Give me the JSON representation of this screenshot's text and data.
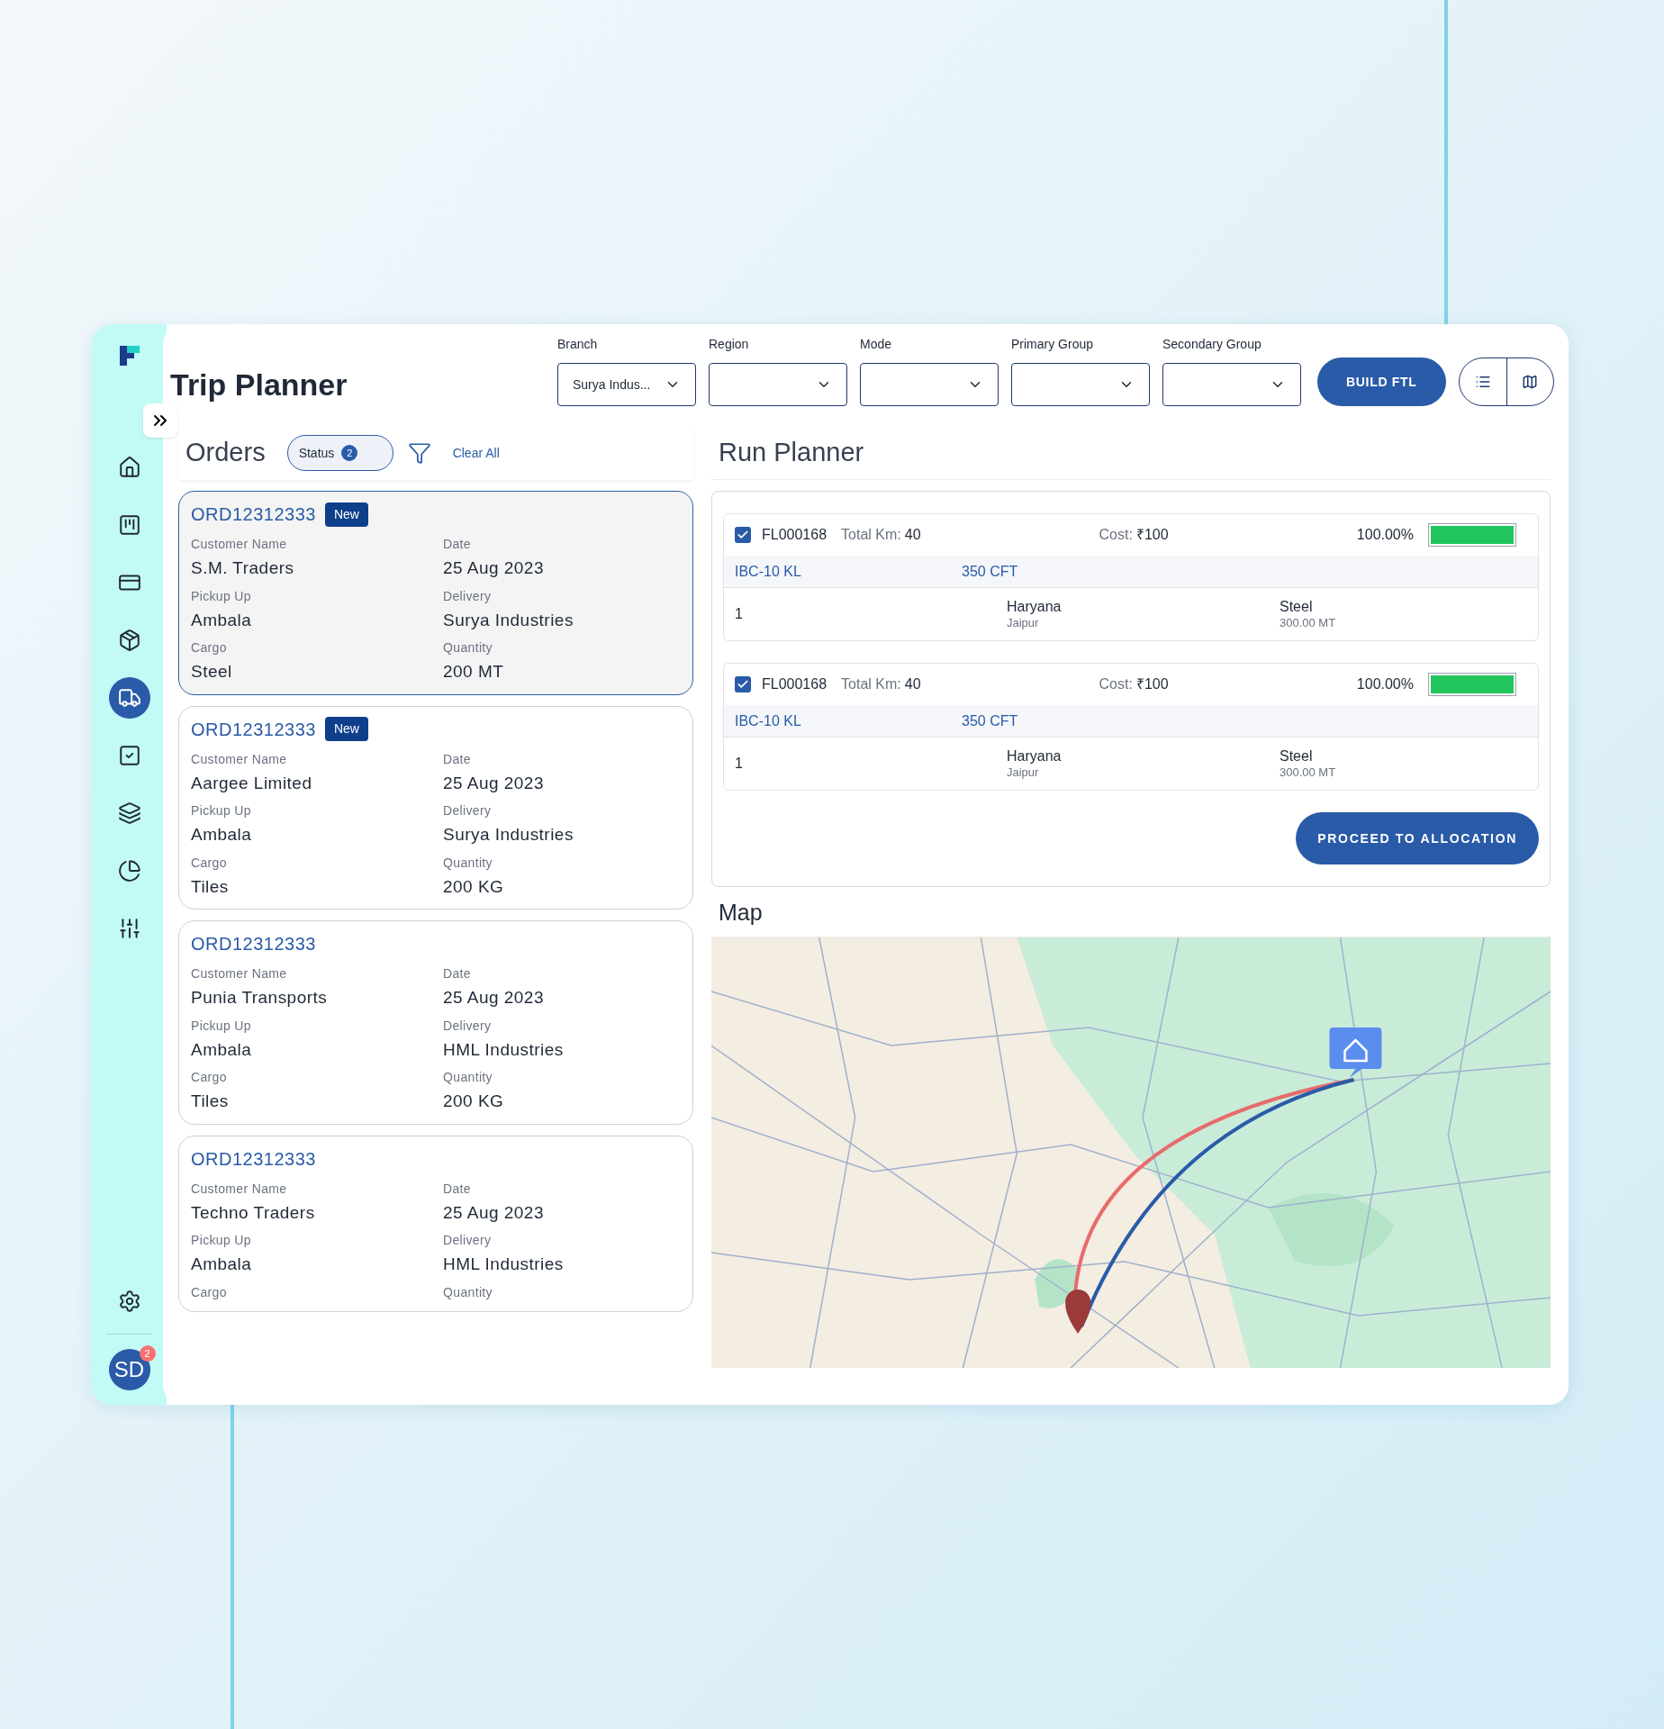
{
  "page": {
    "title": "Trip Planner"
  },
  "sidebar": {
    "items": [
      {
        "selected": false
      },
      {
        "selected": false
      },
      {
        "selected": false
      },
      {
        "selected": false
      },
      {
        "selected": true
      },
      {
        "selected": false
      },
      {
        "selected": false
      },
      {
        "selected": false
      },
      {
        "selected": false
      }
    ],
    "user": {
      "initials": "SD",
      "badge": "2"
    }
  },
  "filters": [
    {
      "label": "Branch",
      "value": "Surya Indus..."
    },
    {
      "label": "Region"
    },
    {
      "label": "Mode"
    },
    {
      "label": "Primary Group"
    },
    {
      "label": "Secondary Group"
    }
  ],
  "build_button": "BUILD FTL",
  "view_toggle": [
    {
      "kind": "list",
      "selected": false
    },
    {
      "kind": "map",
      "selected": false
    }
  ],
  "orders": {
    "title": "Orders",
    "status_chip": {
      "label": "Status",
      "count": "2"
    },
    "clear_all": "Clear All",
    "items": [
      {
        "id": "ORD12312333",
        "badge": "New",
        "selected": true,
        "fields": [
          {
            "label": "Customer Name",
            "value": "S.M. Traders"
          },
          {
            "label": "Date",
            "value": "25 Aug 2023"
          },
          {
            "label": "Pickup Up",
            "value": "Ambala"
          },
          {
            "label": "Delivery",
            "value": "Surya Industries"
          },
          {
            "label": "Cargo",
            "value": "Steel"
          },
          {
            "label": "Quantity",
            "value": "200 MT"
          }
        ]
      },
      {
        "id": "ORD12312333",
        "badge": "New",
        "selected": false,
        "fields": [
          {
            "label": "Customer Name",
            "value": "Aargee Limited"
          },
          {
            "label": "Date",
            "value": "25 Aug 2023"
          },
          {
            "label": "Pickup Up",
            "value": "Ambala"
          },
          {
            "label": "Delivery",
            "value": "Surya Industries"
          },
          {
            "label": "Cargo",
            "value": "Tiles"
          },
          {
            "label": "Quantity",
            "value": "200 KG"
          }
        ]
      },
      {
        "id": "ORD12312333",
        "selected": false,
        "fields": [
          {
            "label": "Customer Name",
            "value": "Punia Transports"
          },
          {
            "label": "Date",
            "value": "25 Aug 2023"
          },
          {
            "label": "Pickup Up",
            "value": "Ambala"
          },
          {
            "label": "Delivery",
            "value": "HML Industries"
          },
          {
            "label": "Cargo",
            "value": "Tiles"
          },
          {
            "label": "Quantity",
            "value": "200 KG"
          }
        ]
      },
      {
        "id": "ORD12312333",
        "selected": false,
        "fields": [
          {
            "label": "Customer Name",
            "value": "Techno Traders"
          },
          {
            "label": "Date",
            "value": "25 Aug 2023"
          },
          {
            "label": "Pickup Up",
            "value": "Ambala"
          },
          {
            "label": "Delivery",
            "value": "HML Industries"
          },
          {
            "label": "Cargo"
          },
          {
            "label": "Quantity"
          }
        ]
      }
    ]
  },
  "run_planner": {
    "title": "Run Planner",
    "trips": [
      {
        "checked": true,
        "code": "FL000168",
        "km_label": "Total Km:",
        "km": "40",
        "cost_label": "Cost:",
        "cost": "₹100",
        "percent": "100.00%",
        "level": 1,
        "vehicle": "IBC-10 KL",
        "capacity": "350 CFT",
        "stops": [
          {
            "index": "1",
            "state": "Haryana",
            "city": "Jaipur",
            "cargo": "Steel",
            "quantity": "300.00 MT"
          }
        ]
      },
      {
        "checked": true,
        "code": "FL000168",
        "km_label": "Total Km:",
        "km": "40",
        "cost_label": "Cost:",
        "cost": "₹100",
        "percent": "100.00%",
        "level": 1,
        "vehicle": "IBC-10 KL",
        "capacity": "350 CFT",
        "stops": [
          {
            "index": "1",
            "state": "Haryana",
            "city": "Jaipur",
            "cargo": "Steel",
            "quantity": "300.00 MT"
          }
        ]
      }
    ],
    "proceed_button": "PROCEED TO ALLOCATION"
  },
  "map": {
    "title": "Map"
  }
}
